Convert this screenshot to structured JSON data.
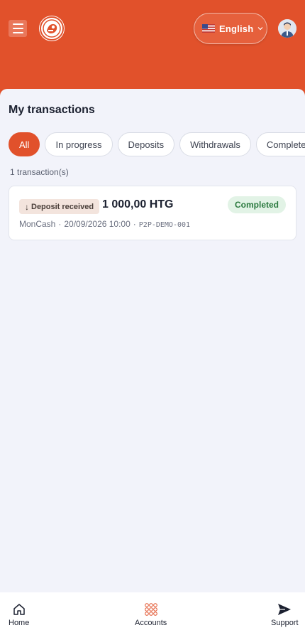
{
  "header": {
    "language": {
      "label": "English",
      "flag_icon": "us-flag-icon"
    },
    "menu_icon": "hamburger-menu-icon",
    "logo_icon": "brand-logo-icon",
    "avatar_icon": "user-avatar-icon",
    "accent_color": "#e1512b"
  },
  "page": {
    "title": "My transactions",
    "filters": [
      {
        "label": "All",
        "active": true
      },
      {
        "label": "In progress",
        "active": false
      },
      {
        "label": "Deposits",
        "active": false
      },
      {
        "label": "Withdrawals",
        "active": false
      },
      {
        "label": "Completed",
        "active": false
      }
    ],
    "count_label": "1 transaction(s)",
    "transactions": [
      {
        "type_label": "Deposit received",
        "type_icon": "arrow-down-icon",
        "amount": "1 000,00 HTG",
        "status": "Completed",
        "status_color": "#2b7a3f",
        "method": "MonCash",
        "separator": "·",
        "datetime": "20/09/2026 10:00",
        "reference": "P2P-DEMO-001"
      }
    ]
  },
  "bottom_nav": {
    "items": [
      {
        "label": "Home",
        "icon": "home-icon"
      },
      {
        "label": "Accounts",
        "icon": "accounts-grid-icon"
      },
      {
        "label": "Support",
        "icon": "send-icon"
      }
    ]
  }
}
